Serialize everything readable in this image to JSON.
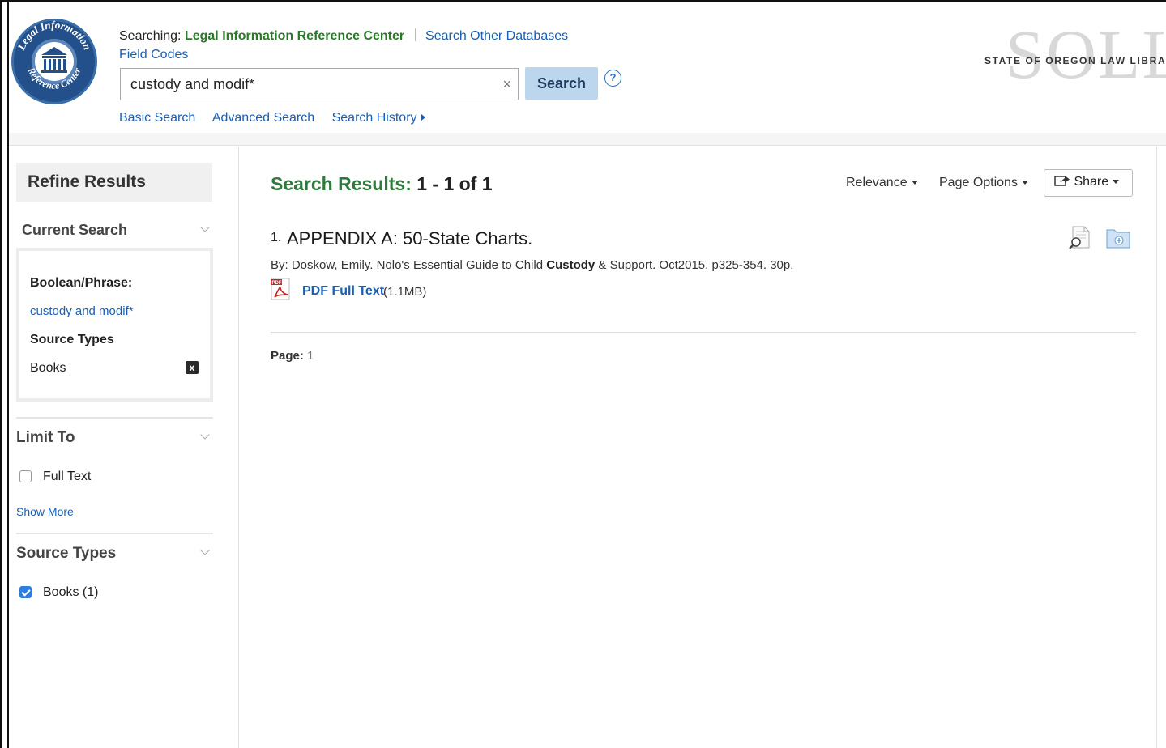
{
  "header": {
    "searching_prefix": "Searching:",
    "database_name": "Legal Information Reference Center",
    "other_databases_link": "Search Other Databases",
    "field_codes_link": "Field Codes",
    "search_value": "custody and modif*",
    "clear_symbol": "×",
    "search_button": "Search",
    "help_symbol": "?",
    "modes": [
      "Basic Search",
      "Advanced Search",
      "Search History"
    ],
    "logo_text_top": "Legal Information",
    "logo_text_bottom": "Reference Center",
    "library_name": "STATE OF OREGON LAW LIBRARY",
    "library_logo_text": "SOLL"
  },
  "sidebar": {
    "title": "Refine Results",
    "current_search": {
      "heading": "Current Search",
      "boolean_label": "Boolean/Phrase:",
      "boolean_value": "custody and modif*",
      "source_types_label": "Source Types",
      "source_types_value": "Books",
      "remove_symbol": "x"
    },
    "limit_to": {
      "heading": "Limit To",
      "full_text_label": "Full Text",
      "full_text_checked": false,
      "show_more": "Show More"
    },
    "source_types": {
      "heading": "Source Types",
      "items": [
        {
          "label": "Books (1)",
          "checked": true
        }
      ]
    }
  },
  "results": {
    "title_prefix": "Search Results:",
    "range": "1 - 1 of 1",
    "sort_label": "Relevance",
    "page_options_label": "Page Options",
    "share_label": "Share",
    "items": [
      {
        "number": "1.",
        "title": "APPENDIX A: 50-State Charts.",
        "by_prefix": "By: Doskow, Emily. Nolo's Essential Guide to Child",
        "by_bold": "Custody",
        "by_suffix": "& Support. Oct2015, p325-354. 30p.",
        "pdf_label": "PDF Full Text",
        "pdf_size": "(1.1MB)",
        "pdf_icon_text": "PDF"
      }
    ],
    "page_label": "Page:",
    "page_number": "1"
  },
  "colors": {
    "database_green": "#2a7a2a",
    "results_green": "#2f7a3e",
    "link_blue": "#1a5fb4",
    "search_button_bg": "#bcd6ee",
    "checkbox_blue": "#2f7de1"
  }
}
